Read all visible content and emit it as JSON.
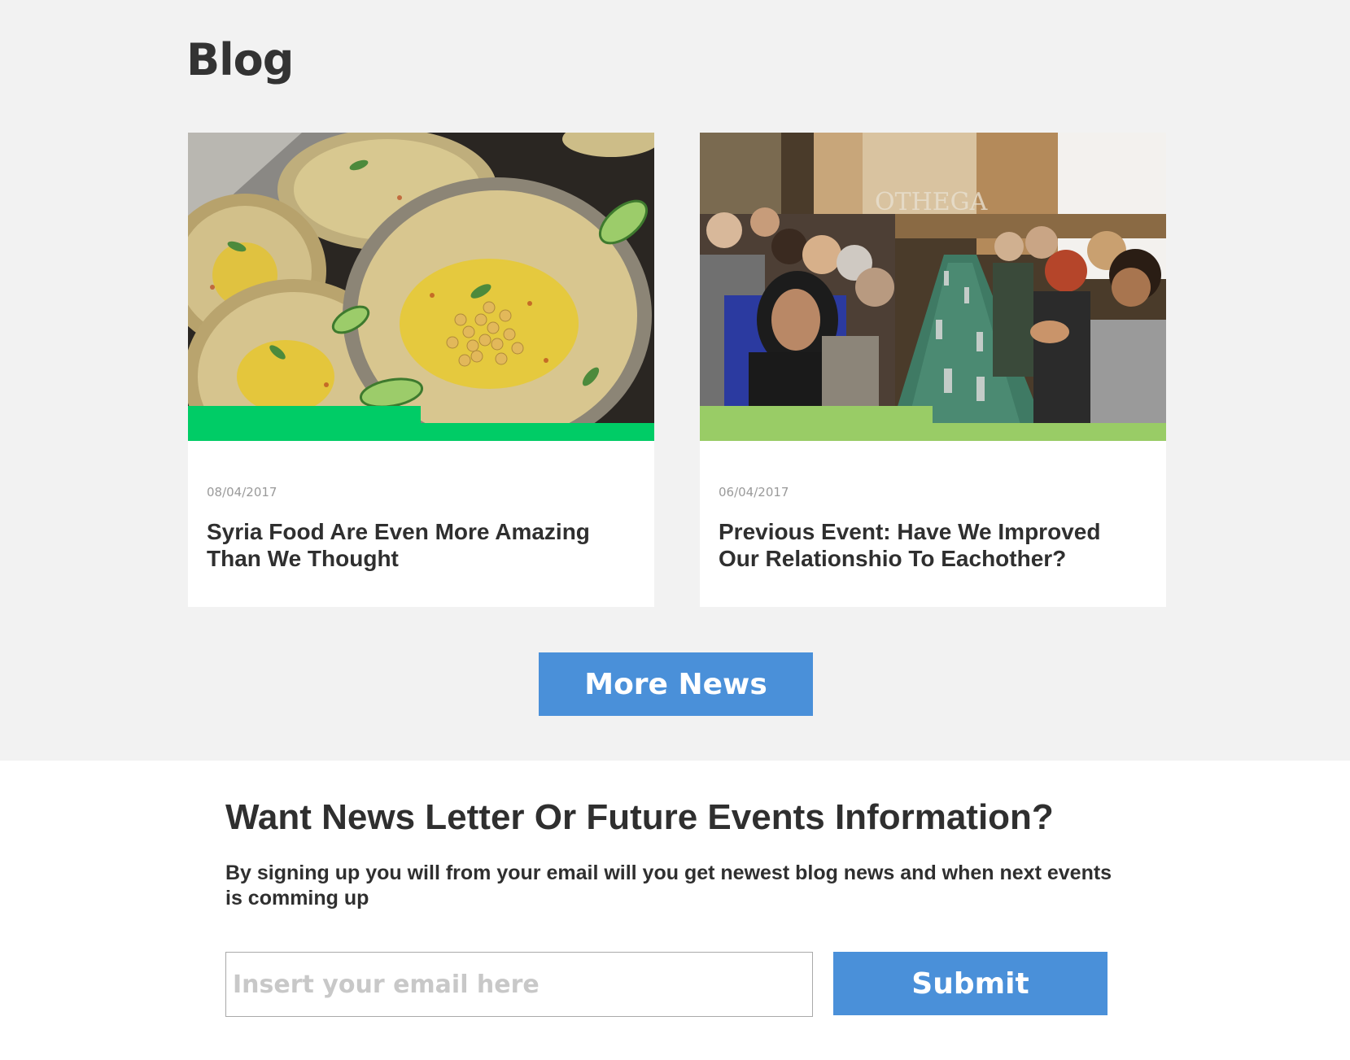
{
  "blog": {
    "title": "Blog",
    "posts": [
      {
        "date": "08/04/2017",
        "title": "Syria Food Are Even More Amazing Than We Thought",
        "accent_color": "#00cc66",
        "image": "hummus-plates-photo"
      },
      {
        "date": "06/04/2017",
        "title": "Previous Event: Have We Improved Our Relationshio To Eachother?",
        "accent_color": "#99cc66",
        "image": "community-dinner-photo"
      }
    ],
    "more_button": "More News"
  },
  "newsletter": {
    "heading": "Want News Letter Or Future Events Information?",
    "text": "By signing up you will from your email will you get newest blog news and when next events is comming up",
    "email_placeholder": "Insert your email here",
    "submit_label": "Submit"
  },
  "colors": {
    "button_blue": "#4a90d9",
    "section_bg": "#f2f2f2"
  }
}
